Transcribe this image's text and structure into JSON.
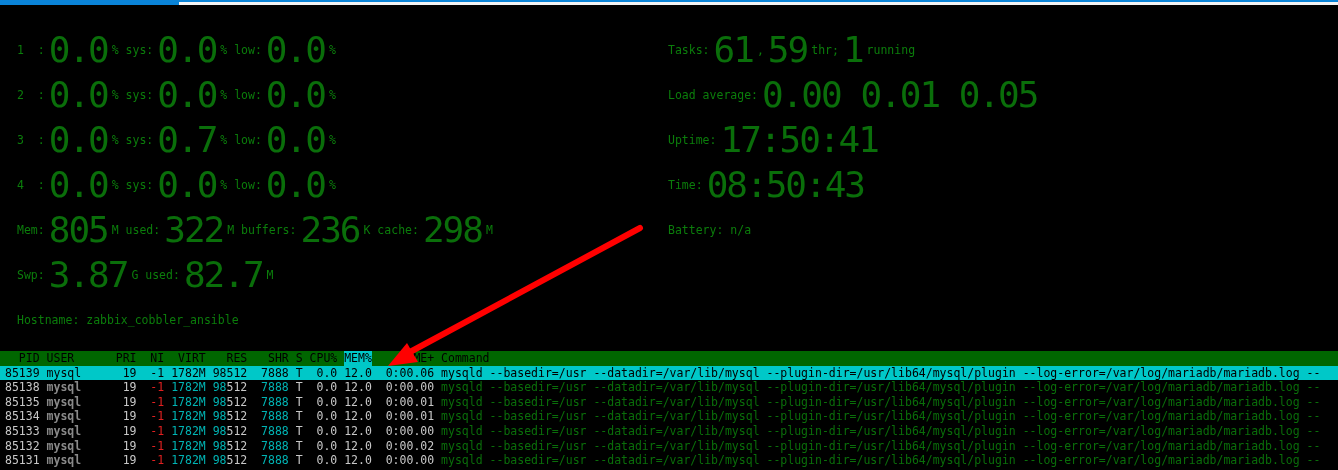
{
  "meters_left": [
    {
      "segments": [
        {
          "kind": "label",
          "text": "1  :"
        },
        {
          "kind": "digits",
          "text": "0.0"
        },
        {
          "kind": "label",
          "text": "% sys:"
        },
        {
          "kind": "digits",
          "text": "0.0"
        },
        {
          "kind": "label",
          "text": "% low:"
        },
        {
          "kind": "digits",
          "text": "0.0"
        },
        {
          "kind": "label",
          "text": "%"
        }
      ]
    },
    {
      "segments": [
        {
          "kind": "label",
          "text": "2  :"
        },
        {
          "kind": "digits",
          "text": "0.0"
        },
        {
          "kind": "label",
          "text": "% sys:"
        },
        {
          "kind": "digits",
          "text": "0.0"
        },
        {
          "kind": "label",
          "text": "% low:"
        },
        {
          "kind": "digits",
          "text": "0.0"
        },
        {
          "kind": "label",
          "text": "%"
        }
      ]
    },
    {
      "segments": [
        {
          "kind": "label",
          "text": "3  :"
        },
        {
          "kind": "digits",
          "text": "0.0"
        },
        {
          "kind": "label",
          "text": "% sys:"
        },
        {
          "kind": "digits",
          "text": "0.7"
        },
        {
          "kind": "label",
          "text": "% low:"
        },
        {
          "kind": "digits",
          "text": "0.0"
        },
        {
          "kind": "label",
          "text": "%"
        }
      ]
    },
    {
      "segments": [
        {
          "kind": "label",
          "text": "4  :"
        },
        {
          "kind": "digits",
          "text": "0.0"
        },
        {
          "kind": "label",
          "text": "% sys:"
        },
        {
          "kind": "digits",
          "text": "0.0"
        },
        {
          "kind": "label",
          "text": "% low:"
        },
        {
          "kind": "digits",
          "text": "0.0"
        },
        {
          "kind": "label",
          "text": "%"
        }
      ]
    },
    {
      "segments": [
        {
          "kind": "label",
          "text": "Mem:"
        },
        {
          "kind": "digits",
          "text": "805"
        },
        {
          "kind": "label",
          "text": "M used:"
        },
        {
          "kind": "digits",
          "text": "322"
        },
        {
          "kind": "label",
          "text": "M buffers:"
        },
        {
          "kind": "digits",
          "text": "236"
        },
        {
          "kind": "label",
          "text": "K cache:"
        },
        {
          "kind": "digits",
          "text": "298"
        },
        {
          "kind": "label",
          "text": "M"
        }
      ]
    },
    {
      "segments": [
        {
          "kind": "label",
          "text": "Swp:"
        },
        {
          "kind": "digits",
          "text": "3.87"
        },
        {
          "kind": "label",
          "text": "G used:"
        },
        {
          "kind": "digits",
          "text": "82.7"
        },
        {
          "kind": "label",
          "text": "M"
        }
      ]
    },
    {
      "segments": [
        {
          "kind": "label",
          "text": "Hostname: zabbix_cobbler_ansible"
        }
      ]
    }
  ],
  "meters_right": [
    {
      "segments": [
        {
          "kind": "label",
          "text": "Tasks:"
        },
        {
          "kind": "digits",
          "text": "61"
        },
        {
          "kind": "label",
          "text": ","
        },
        {
          "kind": "digits",
          "text": "59"
        },
        {
          "kind": "label",
          "text": "thr;"
        },
        {
          "kind": "digits",
          "text": "1"
        },
        {
          "kind": "label",
          "text": "running"
        }
      ]
    },
    {
      "segments": [
        {
          "kind": "label",
          "text": "Load average:"
        },
        {
          "kind": "digits",
          "text": "0.00 0.01 0.05"
        }
      ]
    },
    {
      "segments": [
        {
          "kind": "label",
          "text": "Uptime:"
        },
        {
          "kind": "digits",
          "text": "17:50:41"
        }
      ]
    },
    {
      "segments": [
        {
          "kind": "label",
          "text": "Time:"
        },
        {
          "kind": "digits",
          "text": "08:50:43"
        }
      ]
    },
    {
      "segments": [
        {
          "kind": "label",
          "text": "Battery: n/a"
        }
      ]
    }
  ],
  "table": {
    "columns": [
      {
        "label": "PID",
        "sorted": false
      },
      {
        "label": "USER",
        "sorted": false
      },
      {
        "label": "PRI",
        "sorted": false
      },
      {
        "label": "NI",
        "sorted": false
      },
      {
        "label": "VIRT",
        "sorted": false
      },
      {
        "label": "RES",
        "sorted": false
      },
      {
        "label": "SHR",
        "sorted": false
      },
      {
        "label": "S",
        "sorted": false
      },
      {
        "label": "CPU%",
        "sorted": false
      },
      {
        "label": "MEM%",
        "sorted": true
      },
      {
        "label": "ME+",
        "sorted": false
      },
      {
        "label": "Command",
        "sorted": false
      }
    ],
    "rows": [
      {
        "selected": true,
        "cells": [
          "85139",
          "mysql",
          "19",
          "-1",
          "1782M",
          "98512",
          "7888",
          "T",
          "0.0",
          "12.0",
          "0:00.06",
          "mysqld --basedir=/usr --datadir=/var/lib/mysql --plugin-dir=/usr/lib64/mysql/plugin --log-error=/var/log/mariadb/mariadb.log --"
        ]
      },
      {
        "selected": false,
        "cells": [
          "85138",
          "mysql",
          "19",
          "-1",
          "1782M",
          "98512",
          "7888",
          "T",
          "0.0",
          "12.0",
          "0:00.00",
          "mysqld --basedir=/usr --datadir=/var/lib/mysql --plugin-dir=/usr/lib64/mysql/plugin --log-error=/var/log/mariadb/mariadb.log --"
        ]
      },
      {
        "selected": false,
        "cells": [
          "85135",
          "mysql",
          "19",
          "-1",
          "1782M",
          "98512",
          "7888",
          "T",
          "0.0",
          "12.0",
          "0:00.01",
          "mysqld --basedir=/usr --datadir=/var/lib/mysql --plugin-dir=/usr/lib64/mysql/plugin --log-error=/var/log/mariadb/mariadb.log --"
        ]
      },
      {
        "selected": false,
        "cells": [
          "85134",
          "mysql",
          "19",
          "-1",
          "1782M",
          "98512",
          "7888",
          "T",
          "0.0",
          "12.0",
          "0:00.01",
          "mysqld --basedir=/usr --datadir=/var/lib/mysql --plugin-dir=/usr/lib64/mysql/plugin --log-error=/var/log/mariadb/mariadb.log --"
        ]
      },
      {
        "selected": false,
        "cells": [
          "85133",
          "mysql",
          "19",
          "-1",
          "1782M",
          "98512",
          "7888",
          "T",
          "0.0",
          "12.0",
          "0:00.00",
          "mysqld --basedir=/usr --datadir=/var/lib/mysql --plugin-dir=/usr/lib64/mysql/plugin --log-error=/var/log/mariadb/mariadb.log --"
        ]
      },
      {
        "selected": false,
        "cells": [
          "85132",
          "mysql",
          "19",
          "-1",
          "1782M",
          "98512",
          "7888",
          "T",
          "0.0",
          "12.0",
          "0:00.02",
          "mysqld --basedir=/usr --datadir=/var/lib/mysql --plugin-dir=/usr/lib64/mysql/plugin --log-error=/var/log/mariadb/mariadb.log --"
        ]
      },
      {
        "selected": false,
        "cells": [
          "85131",
          "mysql",
          "19",
          "-1",
          "1782M",
          "98512",
          "7888",
          "T",
          "0.0",
          "12.0",
          "0:00.00",
          "mysqld --basedir=/usr --datadir=/var/lib/mysql --plugin-dir=/usr/lib64/mysql/plugin --log-error=/var/log/mariadb/mariadb.log --"
        ]
      }
    ]
  }
}
